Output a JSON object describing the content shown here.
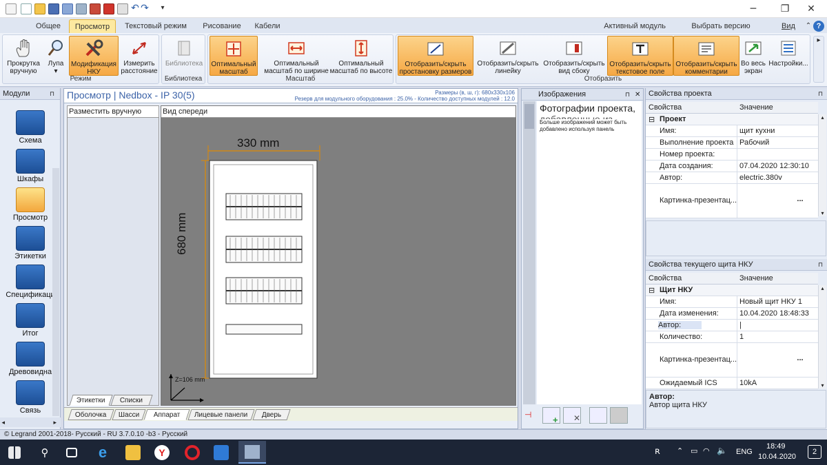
{
  "titlebar": {
    "controls": [
      "minimize-icon",
      "restore-icon",
      "close-icon"
    ]
  },
  "ribbon_tabs": [
    {
      "label": "Общее"
    },
    {
      "label": "Просмотр"
    },
    {
      "label": "Текстовый режим"
    },
    {
      "label": "Рисование"
    },
    {
      "label": "Кабели"
    }
  ],
  "ribbon_right": {
    "active_module": "Активный модуль",
    "select_version": "Выбрать версию программы...",
    "view": "Вид"
  },
  "ribbon": {
    "mode_group": {
      "label": "Режим",
      "buttons": [
        {
          "line1": "Прокрутка",
          "line2": "вручную",
          "icon": "hand-icon"
        },
        {
          "line1": "Лупа",
          "line2": "▾",
          "icon": "magnifier-icon"
        },
        {
          "line1": "Модификация",
          "line2": "НКУ",
          "icon": "tools-icon"
        },
        {
          "line1": "Измерить",
          "line2": "расстояние",
          "icon": "measure-icon"
        }
      ]
    },
    "library_group": {
      "label": "Библиотека",
      "buttons": [
        {
          "line1": "Библиотека",
          "line2": "",
          "icon": "book-icon"
        }
      ]
    },
    "scale_group": {
      "label": "Масштаб",
      "buttons": [
        {
          "line1": "Оптимальный",
          "line2": "масштаб",
          "icon": "fit-icon"
        },
        {
          "line1": "Оптимальный",
          "line2": "масштаб по ширине",
          "icon": "fit-width-icon"
        },
        {
          "line1": "Оптимальный",
          "line2": "масштаб по высоте",
          "icon": "fit-height-icon"
        }
      ]
    },
    "display_group": {
      "label": "Отобразить",
      "buttons": [
        {
          "line1": "Отобразить/скрыть",
          "line2": "простановку размеров",
          "icon": "dimensions-icon"
        },
        {
          "line1": "Отобразить/скрыть",
          "line2": "линейку",
          "icon": "ruler-icon"
        },
        {
          "line1": "Отобразить/скрыть",
          "line2": "вид сбоку",
          "icon": "side-view-icon"
        },
        {
          "line1": "Отобразить/скрыть",
          "line2": "текстовое поле",
          "icon": "text-field-icon"
        },
        {
          "line1": "Отобразить/скрыть",
          "line2": "комментарии",
          "icon": "comments-icon"
        },
        {
          "line1": "Во весь",
          "line2": "экран",
          "icon": "fullscreen-icon"
        },
        {
          "line1": "Настройки...",
          "line2": "",
          "icon": "settings-icon"
        }
      ]
    }
  },
  "modules": {
    "title": "Модули",
    "pin": "ᵠ",
    "items": [
      {
        "label": "Схема",
        "icon": "schema-icon"
      },
      {
        "label": "Шкафы",
        "icon": "gears-icon"
      },
      {
        "label": "Просмотр",
        "icon": "eye-icon"
      },
      {
        "label": "Этикетки",
        "icon": "labels-icon"
      },
      {
        "label": "Спецификаци",
        "icon": "spec-icon"
      },
      {
        "label": "Итог",
        "icon": "summary-icon"
      },
      {
        "label": "Древовидна",
        "icon": "tree-icon"
      },
      {
        "label": "Связь",
        "icon": "link-icon"
      }
    ]
  },
  "document": {
    "title": "Просмотр | Nedbox - IP 30(5)",
    "info1": "Размеры (в, ш, г): 680x330x106",
    "info2": "Резерв для модульного оборудования : 25.0% - Количество доступных модулей : 12.0",
    "left_header": "Разместить вручную",
    "canvas_header": "Вид спереди",
    "width_label": "330 mm",
    "height_label": "680 mm",
    "depth_label": "Z=106 mm",
    "left_tabs": [
      "Этикетки",
      "Списки"
    ],
    "bottom_tabs": [
      "Оболочка",
      "Шасси",
      "Аппарат",
      "Лицевые панели",
      "Дверь"
    ]
  },
  "images_panel": {
    "title": "Изображения",
    "heading": "Фотографии проекта,",
    "heading2": "добавленные из",
    "note1": "Больше изображений может быть",
    "note2": "добавлено используя панель"
  },
  "project_props": {
    "title": "Свойства проекта",
    "col1": "Свойства",
    "col2": "Значение",
    "group": "Проект",
    "rows": [
      {
        "k": "Имя:",
        "v": "щит кухни"
      },
      {
        "k": "Выполнение проекта",
        "v": "Рабочий"
      },
      {
        "k": "Номер проекта:",
        "v": ""
      },
      {
        "k": "Дата создания:",
        "v": "07.04.2020 12:30:10"
      },
      {
        "k": "Автор:",
        "v": "electric.380v"
      }
    ],
    "picture_label": "Картинка-презентац...",
    "ellipsis": "..."
  },
  "panel_props": {
    "title": "Свойства текущего щита НКУ",
    "col1": "Свойства",
    "col2": "Значение",
    "group": "Щит НКУ",
    "rows": [
      {
        "k": "Имя:",
        "v": "Новый щит НКУ 1"
      },
      {
        "k": "Дата изменения:",
        "v": "10.04.2020 18:48:33"
      },
      {
        "k": "Автор:",
        "v": "|"
      },
      {
        "k": "Количество:",
        "v": "1"
      }
    ],
    "picture_label": "Картинка-презентац...",
    "ellipsis": "...",
    "last_row": {
      "k": "Ожидаемый ICS",
      "v": "10kA"
    },
    "help_title": "Автор:",
    "help_text": "Автор щита НКУ"
  },
  "status_bar": "© Legrand 2001-2018- Русский - RU 3.7.0.10 -b3 - Русский",
  "taskbar": {
    "lang": "ENG",
    "time": "18:49",
    "date": "10.04.2020",
    "notifications": "2"
  },
  "colors": {
    "accent_orange": "#f6a844",
    "module_blue": "#1d4f96",
    "doc_title_blue": "#3c63a8",
    "canvas_gray": "#7f7f7f",
    "dimension_orange": "#e08a00"
  }
}
